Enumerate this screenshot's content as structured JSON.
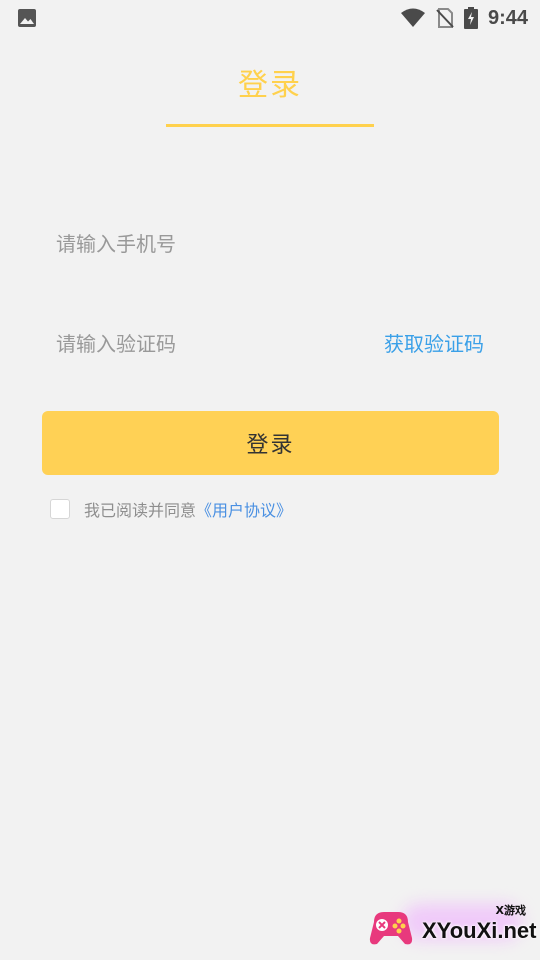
{
  "status_bar": {
    "time": "9:44",
    "icons": [
      "image-icon",
      "wifi-icon",
      "no-sim-icon",
      "battery-charging-icon"
    ]
  },
  "header": {
    "title": "登录"
  },
  "form": {
    "phone_placeholder": "请输入手机号",
    "code_placeholder": "请输入验证码",
    "get_code_label": "获取验证码",
    "login_label": "登录"
  },
  "agreement": {
    "checked": false,
    "text": "我已阅读并同意",
    "link": "《用户协议》"
  },
  "watermark": {
    "small": "X游戏",
    "large": "XYouXi.net"
  },
  "colors": {
    "accent": "#ffd14d",
    "link": "#4a90e2",
    "get_code": "#3aa0e8",
    "background": "#f2f2f2"
  }
}
